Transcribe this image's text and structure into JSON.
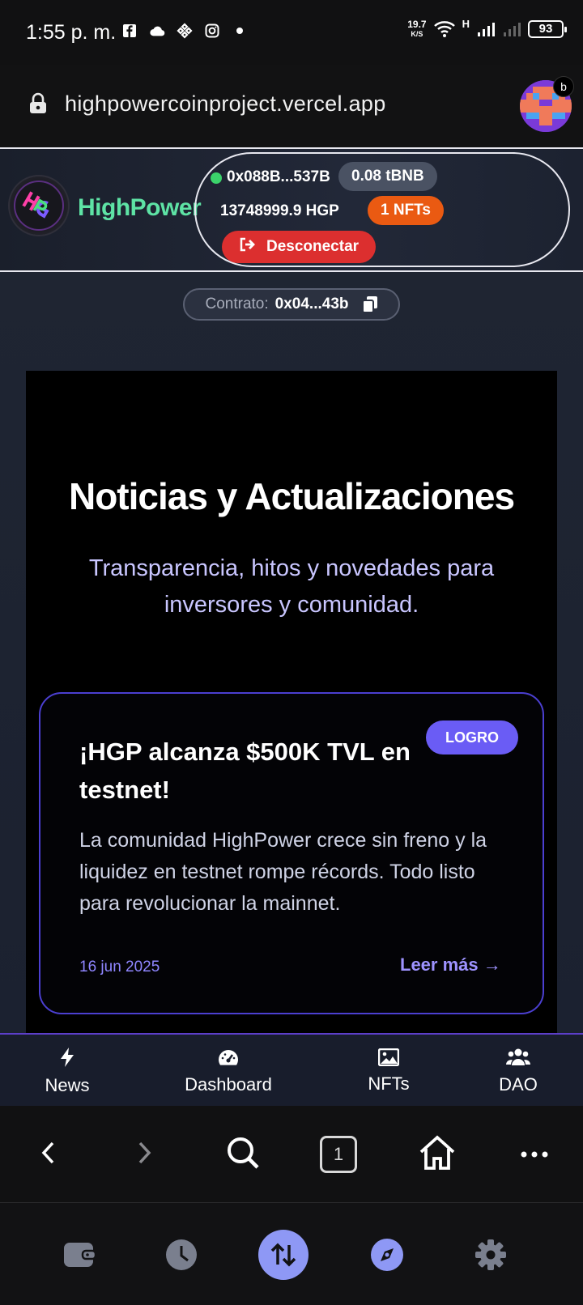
{
  "status": {
    "time": "1:55 p. m.",
    "net_speed_value": "19.7",
    "net_speed_unit": "K/S",
    "network_type": "H",
    "battery": "93"
  },
  "browser": {
    "url": "highpowercoinproject.vercel.app",
    "profile_badge": "b",
    "tab_count": "1"
  },
  "header": {
    "brand": "HighPower",
    "wallet_address": "0x088B...537B",
    "bnb_balance": "0.08 tBNB",
    "hgp_balance": "13748999.9 HGP",
    "nft_count": "1 NFTs",
    "disconnect_label": "Desconectar"
  },
  "contract": {
    "label": "Contrato:",
    "address": "0x04...43b"
  },
  "news": {
    "title": "Noticias y Actualizaciones",
    "subtitle": "Transparencia, hitos y novedades para inversores y comunidad.",
    "card": {
      "badge": "LOGRO",
      "title": "¡HGP alcanza $500K TVL en testnet!",
      "body": "La comunidad HighPower crece sin freno y la liquidez en testnet rompe récords. Todo listo para revolucionar la mainnet.",
      "date": "16 jun 2025",
      "read_more": "Leer más →"
    }
  },
  "bottom_nav": [
    {
      "label": "News",
      "icon": "bolt-icon"
    },
    {
      "label": "Dashboard",
      "icon": "gauge-icon"
    },
    {
      "label": "NFTs",
      "icon": "image-icon"
    },
    {
      "label": "DAO",
      "icon": "users-icon"
    }
  ],
  "colors": {
    "accent": "#6a5cf5",
    "brand_green": "#5ee3a5",
    "danger": "#dc2f2f",
    "nft_orange": "#ea5a12"
  }
}
